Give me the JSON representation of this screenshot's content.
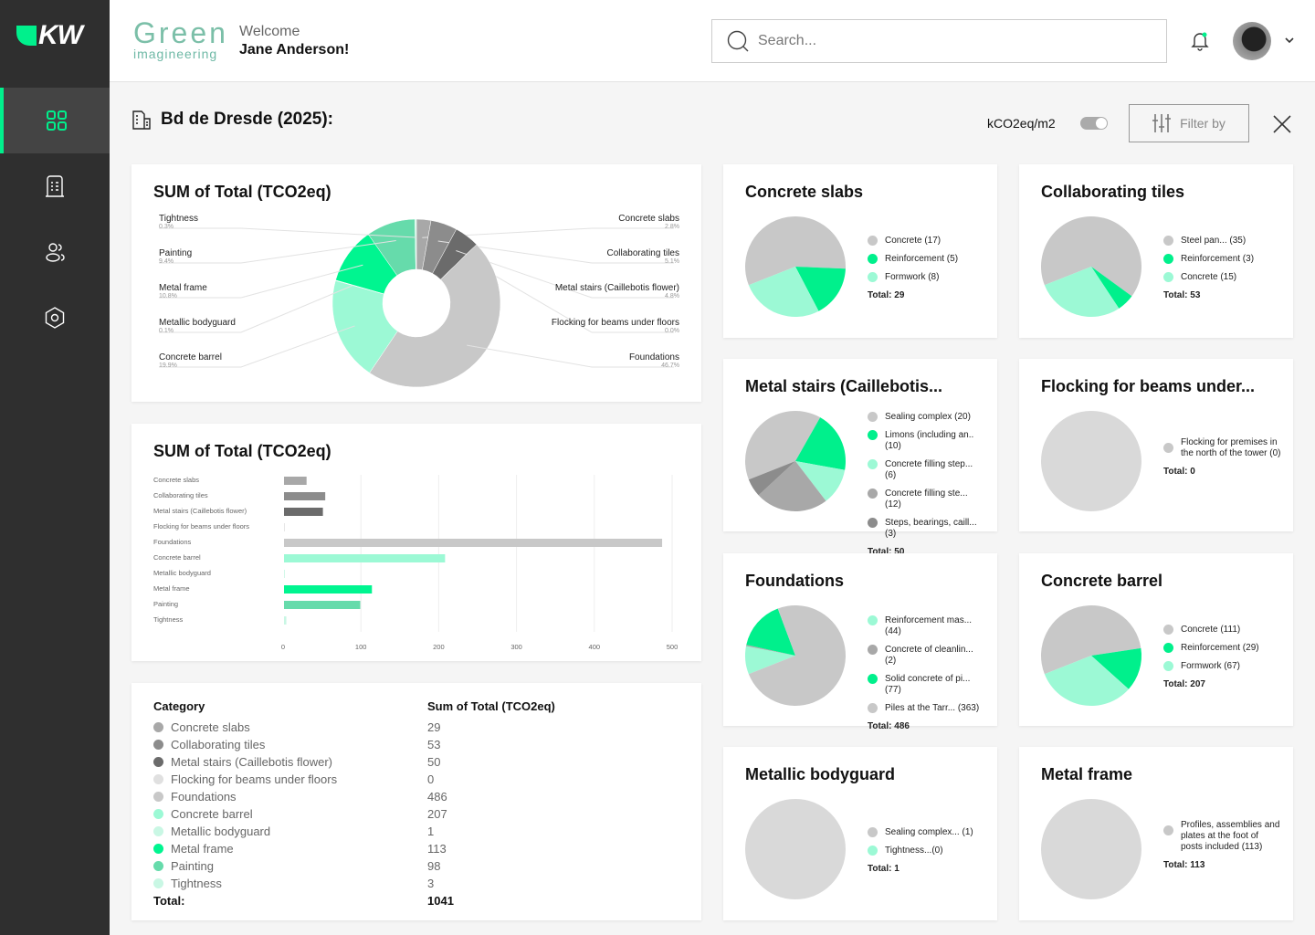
{
  "sidebar": {
    "logo": "KW",
    "items": [
      {
        "icon": "dashboard-grid-icon",
        "active": true
      },
      {
        "icon": "building-icon"
      },
      {
        "icon": "users-icon"
      },
      {
        "icon": "settings-hexagon-icon"
      }
    ]
  },
  "header": {
    "brand_top": "Green",
    "brand_bottom": "imagineering",
    "welcome": "Welcome",
    "user_name": "Jane Anderson!",
    "search_placeholder": "Search..."
  },
  "toolbar": {
    "title": "Bd de Dresde (2025):",
    "unit": "kCO2eq/m2",
    "unit_toggle_on": true,
    "filter_label": "Filter by"
  },
  "colors": {
    "accent": "#00f08c",
    "mint": "#9cf9d5",
    "gray": "#c8c8c8"
  },
  "chart_data": [
    {
      "type": "pie",
      "title": "SUM of Total (TCO2eq)",
      "donut": true,
      "slices": [
        {
          "label": "Concrete slabs",
          "value": 29,
          "pct": "2.8%",
          "color": "#a8a8a8",
          "side": "right"
        },
        {
          "label": "Collaborating tiles",
          "value": 53,
          "pct": "5.1%",
          "color": "#8c8c8c",
          "side": "right"
        },
        {
          "label": "Metal stairs (Caillebotis flower)",
          "value": 50,
          "pct": "4.8%",
          "color": "#6b6b6b",
          "side": "right"
        },
        {
          "label": "Flocking for beams under floors",
          "value": 0,
          "pct": "0.0%",
          "color": "#e0e0e0",
          "side": "right"
        },
        {
          "label": "Foundations",
          "value": 486,
          "pct": "46.7%",
          "color": "#c8c8c8",
          "side": "right"
        },
        {
          "label": "Concrete barrel",
          "value": 207,
          "pct": "19.9%",
          "color": "#9cf9d5",
          "side": "left"
        },
        {
          "label": "Metallic bodyguard",
          "value": 1,
          "pct": "0.1%",
          "color": "#c9f7e4",
          "side": "left"
        },
        {
          "label": "Metal frame",
          "value": 113,
          "pct": "10.8%",
          "color": "#00f590",
          "side": "left"
        },
        {
          "label": "Painting",
          "value": 98,
          "pct": "9.4%",
          "color": "#66dbab",
          "side": "left"
        },
        {
          "label": "Tightness",
          "value": 3,
          "pct": "0.3%",
          "color": "#c9f7e4",
          "side": "left"
        }
      ]
    },
    {
      "type": "bar",
      "title": "SUM of Total (TCO2eq)",
      "orientation": "horizontal",
      "xlim": [
        0,
        500
      ],
      "xticks": [
        0,
        100,
        200,
        300,
        400,
        500
      ],
      "grid": true,
      "categories": [
        "Concrete slabs",
        "Collaborating tiles",
        "Metal stairs (Caillebotis flower)",
        "Flocking for beams under floors",
        "Foundations",
        "Concrete barrel",
        "Metallic bodyguard",
        "Metal frame",
        "Painting",
        "Tightness"
      ],
      "values": [
        29,
        53,
        50,
        0,
        486,
        207,
        1,
        113,
        98,
        3
      ],
      "colors": [
        "#a8a8a8",
        "#8c8c8c",
        "#6b6b6b",
        "#e0e0e0",
        "#c8c8c8",
        "#9cf9d5",
        "#c9f7e4",
        "#00f590",
        "#66dbab",
        "#c9f7e4"
      ]
    }
  ],
  "table": {
    "col1": "Category",
    "col2": "Sum of Total (TCO2eq)",
    "total_label": "Total:",
    "total_value": "1041",
    "rows": [
      {
        "category": "Concrete slabs",
        "value": "29",
        "color": "#a8a8a8"
      },
      {
        "category": "Collaborating tiles",
        "value": "53",
        "color": "#8c8c8c"
      },
      {
        "category": "Metal stairs (Caillebotis flower)",
        "value": "50",
        "color": "#6b6b6b"
      },
      {
        "category": "Flocking for beams under floors",
        "value": "0",
        "color": "#e0e0e0"
      },
      {
        "category": "Foundations",
        "value": "486",
        "color": "#c8c8c8"
      },
      {
        "category": "Concrete barrel",
        "value": "207",
        "color": "#9cf9d5"
      },
      {
        "category": "Metallic bodyguard",
        "value": "1",
        "color": "#c9f7e4"
      },
      {
        "category": "Metal frame",
        "value": "113",
        "color": "#00f590"
      },
      {
        "category": "Painting",
        "value": "98",
        "color": "#66dbab"
      },
      {
        "category": "Tightness",
        "value": "3",
        "color": "#c9f7e4"
      }
    ]
  },
  "small_cards": [
    {
      "title": "Concrete slabs",
      "total": "Total: 29",
      "items": [
        {
          "label": "Concrete (17)",
          "value": 17,
          "color": "#c8c8c8"
        },
        {
          "label": "Reinforcement (5)",
          "value": 5,
          "color": "#00f08c"
        },
        {
          "label": "Formwork (8)",
          "value": 8,
          "color": "#9cf9d5"
        }
      ]
    },
    {
      "title": "Collaborating tiles",
      "total": "Total: 53",
      "items": [
        {
          "label": "Steel pan... (35)",
          "value": 35,
          "color": "#c8c8c8"
        },
        {
          "label": "Reinforcement (3)",
          "value": 3,
          "color": "#00f08c"
        },
        {
          "label": "Concrete (15)",
          "value": 15,
          "color": "#9cf9d5"
        }
      ]
    },
    {
      "title": "Metal stairs (Caillebotis...",
      "total": "Total: 50",
      "items": [
        {
          "label": "Sealing complex (20)",
          "value": 20,
          "color": "#c8c8c8"
        },
        {
          "label": "Limons (including an.. (10)",
          "value": 10,
          "color": "#00f08c"
        },
        {
          "label": "Concrete filling step... (6)",
          "value": 6,
          "color": "#9cf9d5"
        },
        {
          "label": "Concrete filling ste... (12)",
          "value": 12,
          "color": "#a8a8a8"
        },
        {
          "label": "Steps, bearings, caill... (3)",
          "value": 3,
          "color": "#8c8c8c"
        }
      ]
    },
    {
      "title": "Flocking for beams under...",
      "total": "Total: 0",
      "items": [
        {
          "label": "Flocking for premises in the north of the tower (0)",
          "value": 0,
          "color": "#c8c8c8"
        }
      ]
    },
    {
      "title": "Foundations",
      "total": "Total: 486",
      "items": [
        {
          "label": "Reinforcement mas... (44)",
          "value": 44,
          "color": "#9cf9d5"
        },
        {
          "label": "Concrete of cleanlin... (2)",
          "value": 2,
          "color": "#a8a8a8"
        },
        {
          "label": "Solid concrete of pi... (77)",
          "value": 77,
          "color": "#00f08c"
        },
        {
          "label": "Piles at the Tarr... (363)",
          "value": 363,
          "color": "#c8c8c8"
        }
      ]
    },
    {
      "title": "Concrete barrel",
      "total": "Total: 207",
      "items": [
        {
          "label": "Concrete (111)",
          "value": 111,
          "color": "#c8c8c8"
        },
        {
          "label": "Reinforcement (29)",
          "value": 29,
          "color": "#00f08c"
        },
        {
          "label": "Formwork (67)",
          "value": 67,
          "color": "#9cf9d5"
        }
      ]
    },
    {
      "title": "Metallic bodyguard",
      "total": "Total: 1",
      "items": [
        {
          "label": "Sealing complex... (1)",
          "value": 1,
          "color": "#c8c8c8"
        },
        {
          "label": "Tightness...(0)",
          "value": 0,
          "color": "#9cf9d5"
        }
      ]
    },
    {
      "title": "Metal frame",
      "total": "Total: 113",
      "items": [
        {
          "label": "Profiles, assemblies and plates at the foot of posts included (113)",
          "value": 113,
          "color": "#c8c8c8"
        }
      ]
    }
  ]
}
